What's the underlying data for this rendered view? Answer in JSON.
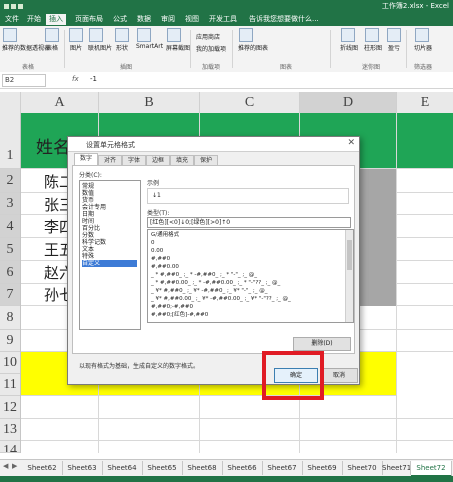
{
  "window": {
    "title": "工作簿2.xlsx - Excel"
  },
  "ribbon_tabs": [
    {
      "label": "文件"
    },
    {
      "label": "开始"
    },
    {
      "label": "插入"
    },
    {
      "label": "页面布局"
    },
    {
      "label": "公式"
    },
    {
      "label": "数据"
    },
    {
      "label": "审阅"
    },
    {
      "label": "视图"
    },
    {
      "label": "开发工具"
    },
    {
      "label": "告诉我您想要做什么..."
    }
  ],
  "ribbon": {
    "buttons": [
      "推荐的数据透视表",
      "表格",
      "图片",
      "联机图片",
      "形状",
      "SmartArt",
      "屏幕截图",
      "推荐的图表",
      "折线图",
      "柱形图",
      "盈亏",
      "切片器"
    ],
    "small": [
      "应用商店",
      "我的加载项"
    ],
    "groups": [
      "表格",
      "插图",
      "加载项",
      "图表",
      "迷你图",
      "筛选器"
    ]
  },
  "formula_bar": {
    "name_box": "B2",
    "fx": "fx",
    "value": "-1"
  },
  "grid": {
    "columns": [
      "A",
      "B",
      "C",
      "D",
      "E"
    ],
    "rows": [
      "1",
      "2",
      "3",
      "4",
      "5",
      "6",
      "7",
      "8",
      "9",
      "10",
      "11",
      "12",
      "13",
      "14"
    ],
    "header_text": "姓名",
    "names": [
      "陈二",
      "张三",
      "李四",
      "王五",
      "赵六",
      "孙七"
    ],
    "colors": {
      "green": "#1fa556",
      "yellow": "#ffff00",
      "grey": "#a6a6a6"
    }
  },
  "sheet_tabs": [
    "Sheet62",
    "Sheet63",
    "Sheet64",
    "Sheet65",
    "Sheet68",
    "Sheet66",
    "Sheet67",
    "Sheet69",
    "Sheet70",
    "Sheet71",
    "Sheet72"
  ],
  "active_sheet": "Sheet72",
  "dialog": {
    "title": "设置单元格格式",
    "close": "✕",
    "tabs": [
      "数字",
      "对齐",
      "字体",
      "边框",
      "填充",
      "保护"
    ],
    "category_label": "分类(C):",
    "categories": [
      "常规",
      "数值",
      "货币",
      "会计专用",
      "日期",
      "时间",
      "百分比",
      "分数",
      "科学记数",
      "文本",
      "特殊",
      "自定义"
    ],
    "selected_category": "自定义",
    "sample_label": "示例",
    "sample_value": "↓1",
    "type_label": "类型(T):",
    "type_value": "[红色][<0]↓0;[绿色][>0]↑0",
    "formats": [
      "G/通用格式",
      "0",
      "0.00",
      "#,##0",
      "#,##0.00",
      "_ * #,##0_ ;_ * -#,##0_ ;_ * \"-\"_ ;_ @_",
      "_ * #,##0.00_ ;_ * -#,##0.00_ ;_ * \"-\"??_ ;_ @_",
      "_ ¥* #,##0_ ;_ ¥* -#,##0_ ;_ ¥* \"-\"_ ;_ @_",
      "_ ¥* #,##0.00_ ;_ ¥* -#,##0.00_ ;_ ¥* \"-\"??_ ;_ @_",
      "#,##0;-#,##0",
      "#,##0;[红色]-#,##0"
    ],
    "delete_button": "删除(D)",
    "description": "以现有格式为基础，生成自定义的数字格式。",
    "ok_button": "确定",
    "cancel_button": "取消"
  }
}
